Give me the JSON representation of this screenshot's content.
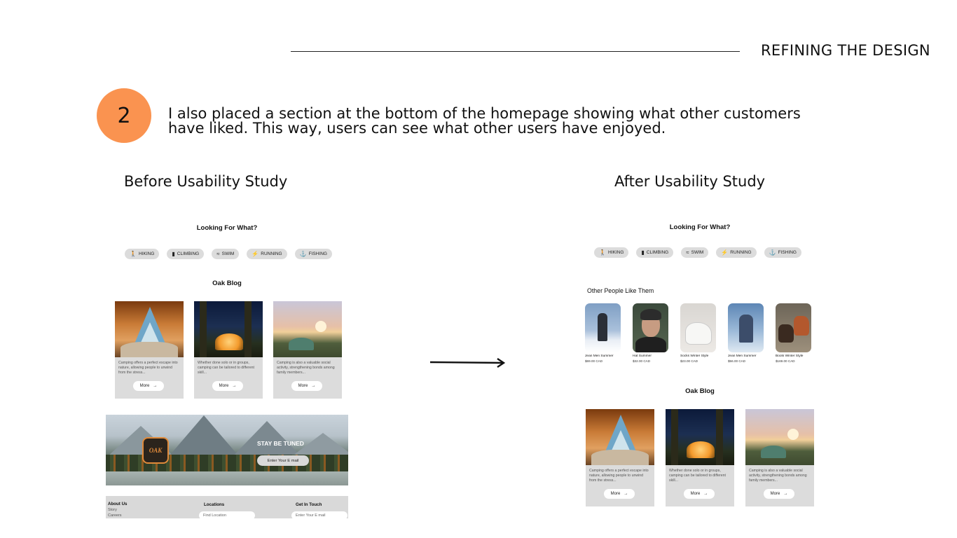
{
  "header": {
    "title": "REFINING THE DESIGN"
  },
  "step": {
    "number": "2",
    "text": "I also placed a section at the bottom of the homepage showing what other customers have liked. This way, users can see what other users have enjoyed."
  },
  "before": {
    "label": "Before Usability Study",
    "heading": "Looking For What?",
    "chips": [
      {
        "label": "HIKING",
        "icon": "hiking-icon"
      },
      {
        "label": "CLIMBING",
        "icon": "climbing-icon"
      },
      {
        "label": "SWIM",
        "icon": "swim-icon"
      },
      {
        "label": "RUNNING",
        "icon": "running-icon"
      },
      {
        "label": "FISHING",
        "icon": "fishing-icon"
      }
    ],
    "blog_title": "Oak Blog",
    "cards": [
      {
        "text": "Camping offers a perfect escape into nature, allowing people to unwind from the stress...",
        "button": "More"
      },
      {
        "text": "Whether done solo or in groups, camping can be tailored to different skill...",
        "button": "More"
      },
      {
        "text": "Camping is also a valuable social activity, strengthening bonds among family members...",
        "button": "More"
      }
    ],
    "banner": {
      "logo": "OAK",
      "title": "STAY BE TUNED",
      "email_placeholder": "Enter Your E mail"
    },
    "footer": {
      "about": "About Us",
      "story": "Story",
      "careers": "Careers",
      "locations": "Locations",
      "find_location": "Find Location",
      "get_in_touch": "Get In Touch",
      "email": "Enter Your E mail"
    }
  },
  "after": {
    "label": "After Usability Study",
    "heading": "Looking For What?",
    "chips": [
      {
        "label": "HIKING",
        "icon": "hiking-icon"
      },
      {
        "label": "CLIMBING",
        "icon": "climbing-icon"
      },
      {
        "label": "SWIM",
        "icon": "swim-icon"
      },
      {
        "label": "RUNNING",
        "icon": "running-icon"
      },
      {
        "label": "FISHING",
        "icon": "fishing-icon"
      }
    ],
    "others_title": "Other People Like Them",
    "products": [
      {
        "name": "Jean Men Summer",
        "price": "$69.00 CAD"
      },
      {
        "name": "Hat  Summer",
        "price": "$32.00 CAD"
      },
      {
        "name": "Socks Winter Style",
        "price": "$23.00 CAD"
      },
      {
        "name": "Jean Men Summer",
        "price": "$56.00 CAD"
      },
      {
        "name": "Boots Winter Style",
        "price": "$169.00 CAD"
      }
    ],
    "blog_title": "Oak Blog",
    "cards": [
      {
        "text": "Camping offers a perfect escape into nature, allowing people to unwind from the stress...",
        "button": "More"
      },
      {
        "text": "Whether done solo or in groups, camping can be tailored to different skill...",
        "button": "More"
      },
      {
        "text": "Camping is also a valuable social activity, strengthening bonds among family members...",
        "button": "More"
      }
    ]
  },
  "colors": {
    "accent": "#fa9350",
    "chip": "#dcdcdc",
    "card": "#dcdcdc"
  }
}
